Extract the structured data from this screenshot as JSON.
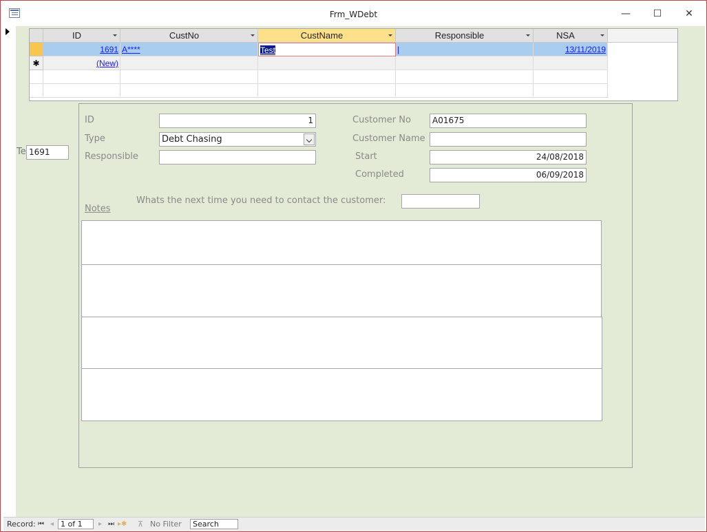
{
  "window": {
    "title": "Frm_WDebt",
    "minimize": "—",
    "maximize": "☐",
    "close": "✕"
  },
  "grid": {
    "columns": [
      {
        "label": "ID"
      },
      {
        "label": "CustNo"
      },
      {
        "label": "CustName"
      },
      {
        "label": "Responsible"
      },
      {
        "label": "NSA"
      }
    ],
    "record": {
      "id": "1691",
      "custno": "A****",
      "custname": "Test",
      "responsible": "|",
      "nsa": "13/11/2019"
    },
    "new_row_marker": "✱",
    "new_row_label": "(New)"
  },
  "side_field": {
    "label": "Te",
    "value": "1691"
  },
  "detail": {
    "id_label": "ID",
    "id_value": "1",
    "type_label": "Type",
    "type_value": "Debt Chasing",
    "responsible_label": "Responsible",
    "responsible_value": "",
    "customer_no_label": "Customer No",
    "customer_no_value": "A01675",
    "customer_name_label": "Customer Name",
    "customer_name_value": "",
    "start_label": "Start",
    "start_value": "24/08/2018",
    "completed_label": "Completed",
    "completed_value": "06/09/2018",
    "notes_label": "Notes",
    "next_contact_label": "Whats the next time you need to contact the customer:",
    "next_contact_value": ""
  },
  "statusbar": {
    "record_label": "Record:",
    "first": "⏮",
    "prev": "◂",
    "position": "1 of 1",
    "next": "▸",
    "last": "⏭",
    "new": "▸✱",
    "filter_icon": "⊼",
    "filter_label": "No Filter",
    "search_placeholder": "Search"
  },
  "colors": {
    "form_background": "#e3ead6",
    "selected_row": "#a9cdef",
    "active_header": "#fce08a",
    "window_border": "#b7474d",
    "link": "#1a1aff"
  }
}
